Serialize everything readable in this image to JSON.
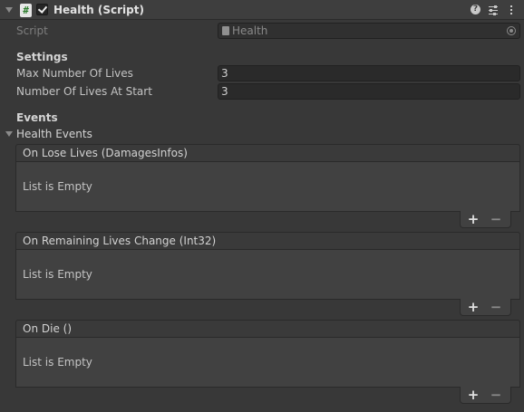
{
  "component": {
    "title": "Health (Script)",
    "enabled": true,
    "script_icon_glyph": "#",
    "icons": [
      "help-icon",
      "presets-icon",
      "kebab-icon"
    ]
  },
  "script_field": {
    "label": "Script",
    "value": "Health"
  },
  "settings": {
    "header": "Settings",
    "max_lives_label": "Max Number Of Lives",
    "max_lives_value": "3",
    "start_lives_label": "Number Of Lives At Start",
    "start_lives_value": "3"
  },
  "events": {
    "header": "Events",
    "foldout_label": "Health Events",
    "items": [
      {
        "title": "On Lose Lives (DamagesInfos)",
        "empty_text": "List is Empty"
      },
      {
        "title": "On Remaining Lives Change (Int32)",
        "empty_text": "List is Empty"
      },
      {
        "title": "On Die ()",
        "empty_text": "List is Empty"
      }
    ],
    "add_label": "+",
    "remove_label": "−"
  }
}
